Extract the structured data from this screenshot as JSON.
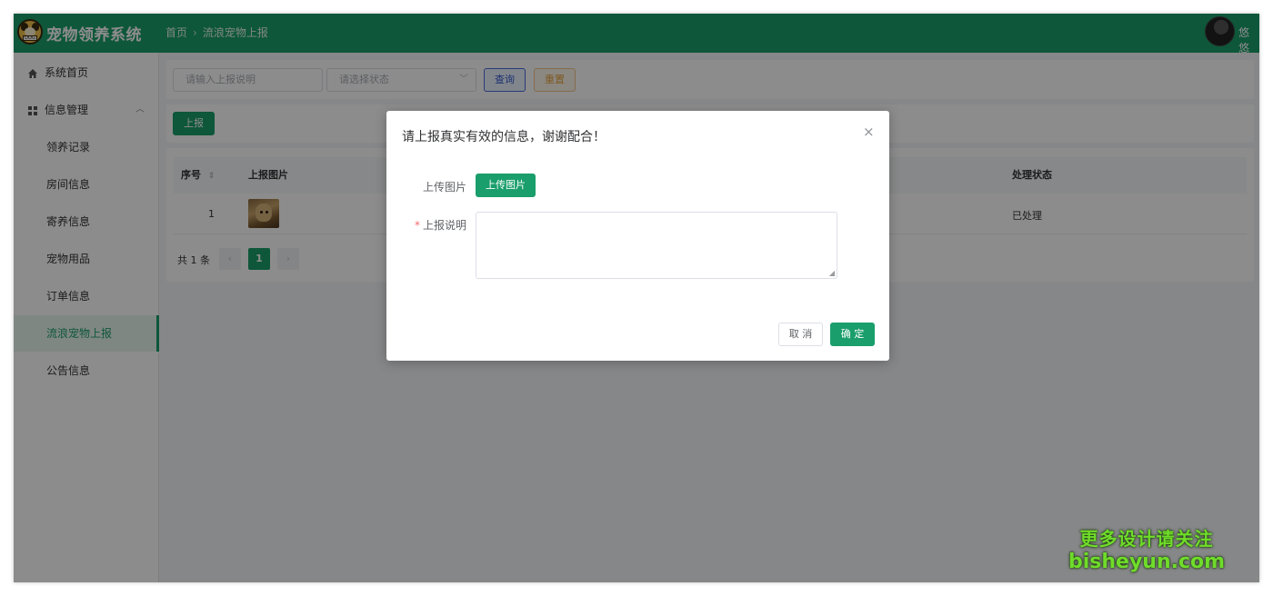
{
  "header": {
    "app_title": "宠物领养系统",
    "breadcrumb_home": "首页",
    "breadcrumb_sep": "›",
    "breadcrumb_current": "流浪宠物上报",
    "username": "悠悠",
    "brand_color": "#1a9e6b",
    "logo_tag": "DOG"
  },
  "sidebar": {
    "items": [
      {
        "label": "系统首页",
        "icon": "home-icon"
      },
      {
        "label": "信息管理",
        "icon": "grid-icon",
        "expanded": true
      },
      {
        "label": "领养记录"
      },
      {
        "label": "房间信息"
      },
      {
        "label": "寄养信息"
      },
      {
        "label": "宠物用品"
      },
      {
        "label": "订单信息"
      },
      {
        "label": "流浪宠物上报",
        "active": true
      },
      {
        "label": "公告信息"
      }
    ]
  },
  "search": {
    "desc_placeholder": "请输入上报说明",
    "status_placeholder": "请选择状态",
    "query_label": "查询",
    "reset_label": "重置"
  },
  "toolbar": {
    "report_label": "上报"
  },
  "table": {
    "columns": [
      "序号",
      "上报图片",
      "处理状态"
    ],
    "rows": [
      {
        "index": "1",
        "image": "dog-photo",
        "status": "已处理"
      }
    ]
  },
  "pagination": {
    "total_text": "共 1 条",
    "current_page": "1",
    "prev": "‹",
    "next": "›"
  },
  "modal": {
    "title": "请上报真实有效的信息，谢谢配合！",
    "close": "×",
    "upload_label": "上传图片",
    "upload_button": "上传图片",
    "desc_required_mark": "*",
    "desc_label": "上报说明",
    "desc_value": "",
    "cancel_label": "取 消",
    "confirm_label": "确 定"
  },
  "watermark": {
    "line1": "更多设计请关注",
    "line2": "bisheyun.com"
  }
}
